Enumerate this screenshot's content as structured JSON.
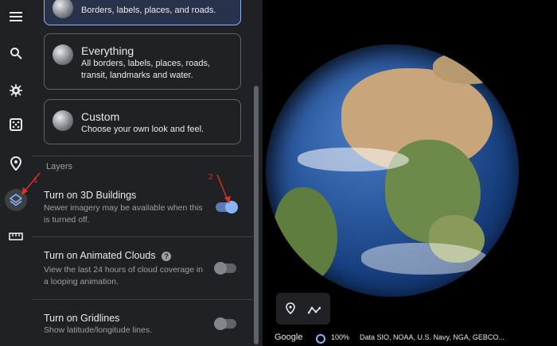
{
  "map_styles": {
    "exploration": {
      "desc": "Borders, labels, places, and roads."
    },
    "everything": {
      "title": "Everything",
      "desc": "All borders, labels, places, roads, transit, landmarks and water."
    },
    "custom": {
      "title": "Custom",
      "desc": "Choose your own look and feel."
    }
  },
  "layers": {
    "heading": "Layers",
    "items": [
      {
        "title": "Turn on 3D Buildings",
        "desc": "Newer imagery may be available when this is turned off.",
        "on": true
      },
      {
        "title": "Turn on Animated Clouds",
        "desc": "View the last 24 hours of cloud coverage in a looping animation.",
        "on": false
      },
      {
        "title": "Turn on Gridlines",
        "desc": "Show latitude/longitude lines.",
        "on": false
      }
    ]
  },
  "annotations": {
    "marker1": "1",
    "marker2": "2"
  },
  "footer": {
    "brand": "Google",
    "zoom": "100%",
    "attribution": "Data SIO, NOAA, U.S. Navy, NGA, GEBCO..."
  },
  "rail_icons": [
    "menu-icon",
    "search-icon",
    "voyager-icon",
    "random-dice-icon",
    "projects-pin-icon",
    "map-style-layers-icon",
    "measure-ruler-icon"
  ],
  "colors": {
    "panel": "#202124",
    "accent": "#8ab4f8",
    "annotation": "#d93025"
  }
}
